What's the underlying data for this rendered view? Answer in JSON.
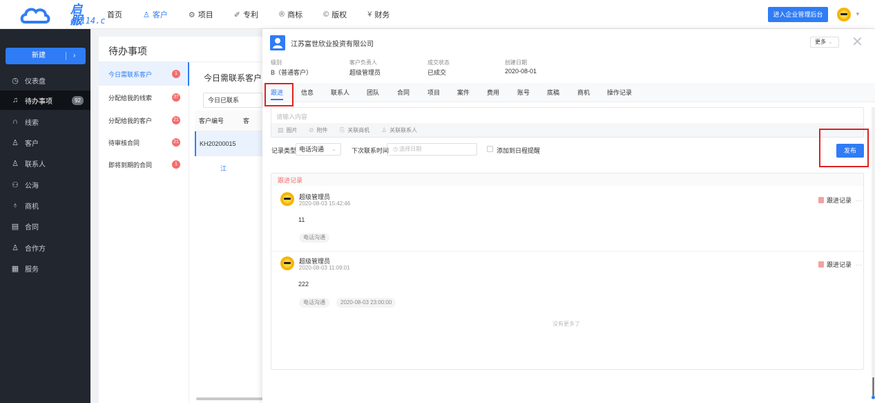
{
  "brand": {
    "name": "启服",
    "url_text": "qf114.c"
  },
  "nav": [
    {
      "label": "首页",
      "icon": ""
    },
    {
      "label": "客户",
      "icon": "people-icon",
      "glyph": "♙"
    },
    {
      "label": "项目",
      "icon": "gear-icon",
      "glyph": "⚙"
    },
    {
      "label": "专利",
      "icon": "feather-icon",
      "glyph": "✐"
    },
    {
      "label": "商标",
      "icon": "registered-icon",
      "glyph": "®"
    },
    {
      "label": "版权",
      "icon": "copyright-icon",
      "glyph": "©"
    },
    {
      "label": "财务",
      "icon": "yen-icon",
      "glyph": "¥"
    }
  ],
  "header": {
    "enter_admin": "进入企业管理后台"
  },
  "sidebar": {
    "new_label": "新建",
    "new_arrow": "›",
    "items": [
      {
        "label": "仪表盘",
        "glyph": "◷"
      },
      {
        "label": "待办事项",
        "glyph": "🔔",
        "count": "92"
      },
      {
        "label": "线索",
        "glyph": "∩"
      },
      {
        "label": "客户",
        "glyph": "♙"
      },
      {
        "label": "联系人",
        "glyph": "♙"
      },
      {
        "label": "公海",
        "glyph": "⚇"
      },
      {
        "label": "商机",
        "glyph": "♁"
      },
      {
        "label": "合同",
        "glyph": "▤"
      },
      {
        "label": "合作方",
        "glyph": "♙"
      },
      {
        "label": "服务",
        "glyph": "▦"
      }
    ]
  },
  "todo": {
    "title": "待办事项",
    "items": [
      {
        "label": "今日需联系客户",
        "badge": "1"
      },
      {
        "label": "分配给我的线索",
        "badge": "37"
      },
      {
        "label": "分配给我的客户",
        "badge": "21"
      },
      {
        "label": "待审核合同",
        "badge": "21"
      },
      {
        "label": "即将到期的合同",
        "badge": "1"
      }
    ]
  },
  "list": {
    "title": "今日需联系客户",
    "filter": "今日已联系",
    "col1": "客户编号",
    "col2": "客",
    "row1_id": "KH20200015",
    "row1_c2": "江"
  },
  "detail": {
    "company": "江苏富世欣业投资有限公司",
    "more": "更多",
    "info": [
      {
        "label": "级别",
        "value": "B（普通客户）"
      },
      {
        "label": "客户负责人",
        "value": "超级管理员"
      },
      {
        "label": "成交状态",
        "value": "已成交"
      },
      {
        "label": "创建日期",
        "value": "2020-08-01"
      }
    ],
    "tabs": [
      "跟进",
      "信息",
      "联系人",
      "团队",
      "合同",
      "项目",
      "案件",
      "费用",
      "账号",
      "底稿",
      "商机",
      "操作记录"
    ],
    "editor_placeholder": "请输入内容",
    "tools": [
      {
        "label": "图片",
        "glyph": "▨"
      },
      {
        "label": "附件",
        "glyph": "⊘"
      },
      {
        "label": "关联商机",
        "glyph": "⎘"
      },
      {
        "label": "关联联系人",
        "glyph": "♙"
      }
    ],
    "record_type_label": "记录类型",
    "record_type_value": "电话沟通",
    "next_contact_label": "下次联系时间",
    "date_placeholder": "选择日期",
    "add_schedule_label": "添加到日程提醒",
    "publish": "发布",
    "records_title": "跟进记录",
    "entries": [
      {
        "name": "超级管理员",
        "time": "2020-08-03 15:42:46",
        "type": "跟进记录",
        "content": "11",
        "tags": [
          "电话沟通"
        ]
      },
      {
        "name": "超级管理员",
        "time": "2020-08-03 11:09:01",
        "type": "跟进记录",
        "content": "222",
        "tags": [
          "电话沟通",
          "2020-08-03 23:00:00"
        ]
      }
    ],
    "no_more": "没有更多了"
  },
  "colors": {
    "accent": "#2f7cf6",
    "sidebar_bg": "#22262e",
    "badge_red": "#f56c6c",
    "highlight_box": "#e02020"
  }
}
